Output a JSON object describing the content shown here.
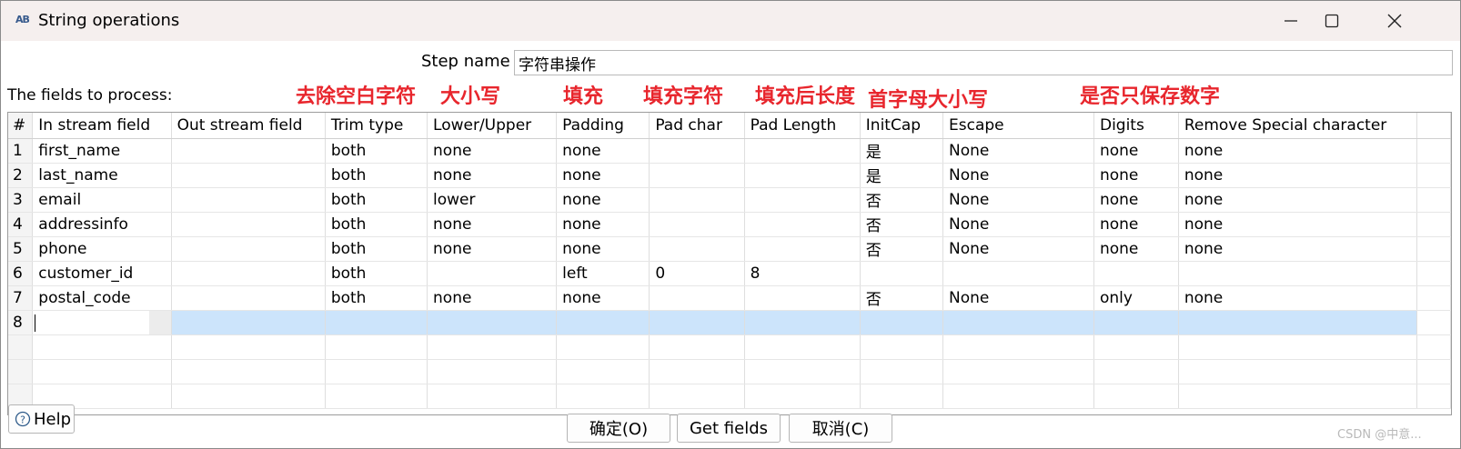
{
  "window": {
    "title": "String operations",
    "app_icon": "AB"
  },
  "step": {
    "label": "Step name",
    "value": "字符串操作"
  },
  "fields_label": "The fields to process:",
  "annotations": [
    "去除空白字符",
    "大小写",
    "填充",
    "填充字符",
    "填充后长度",
    "首字母大小写",
    "是否只保存数字"
  ],
  "annotation_color": "#e8262d",
  "selection_color": "#cce4fb",
  "columns": [
    "#",
    "In stream field",
    "Out stream field",
    "Trim type",
    "Lower/Upper",
    "Padding",
    "Pad char",
    "Pad Length",
    "InitCap",
    "Escape",
    "Digits",
    "Remove Special character"
  ],
  "rows": [
    [
      "1",
      "first_name",
      "",
      "both",
      "none",
      "none",
      "",
      "",
      "是",
      "None",
      "none",
      "none"
    ],
    [
      "2",
      "last_name",
      "",
      "both",
      "none",
      "none",
      "",
      "",
      "是",
      "None",
      "none",
      "none"
    ],
    [
      "3",
      "email",
      "",
      "both",
      "lower",
      "none",
      "",
      "",
      "否",
      "None",
      "none",
      "none"
    ],
    [
      "4",
      "addressinfo",
      "",
      "both",
      "none",
      "none",
      "",
      "",
      "否",
      "None",
      "none",
      "none"
    ],
    [
      "5",
      "phone",
      "",
      "both",
      "none",
      "none",
      "",
      "",
      "否",
      "None",
      "none",
      "none"
    ],
    [
      "6",
      "customer_id",
      "",
      "both",
      "",
      "left",
      "0",
      "8",
      "",
      "",
      "",
      ""
    ],
    [
      "7",
      "postal_code",
      "",
      "both",
      "none",
      "none",
      "",
      "",
      "否",
      "None",
      "only",
      "none"
    ],
    [
      "8",
      "",
      "",
      "",
      "",
      "",
      "",
      "",
      "",
      "",
      "",
      ""
    ]
  ],
  "buttons": {
    "help": "Help",
    "ok": "确定(O)",
    "get_fields": "Get fields",
    "cancel": "取消(C)"
  },
  "watermark": "CSDN @中意..."
}
